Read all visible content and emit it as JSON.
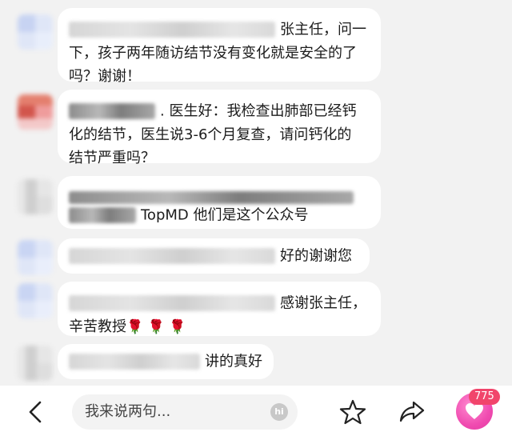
{
  "messages": [
    {
      "line1": "张主任，问一",
      "line2": "下，孩子两年随访结节没有变化就是安全的了",
      "line3": "吗？谢谢！"
    },
    {
      "line1": ". 医生好：我检查出肺部已经钙",
      "line2": "化的结节，医生说3-6个月复查，请问钙化的",
      "line3": "结节严重吗？"
    },
    {
      "line2": "TopMD 他们是这个公众号"
    },
    {
      "line1": "好的谢谢您"
    },
    {
      "line1": "感谢张主任，",
      "line2": "辛苦教授",
      "emoji": "🌹 🌹 🌹"
    },
    {
      "line1": "讲的真好"
    }
  ],
  "bottom_bar": {
    "input_placeholder": "我来说两句...",
    "hi_label": "hi",
    "like_count": "775",
    "icons": [
      "back-arrow-icon",
      "star-icon",
      "share-icon",
      "heart-icon"
    ]
  },
  "colors": {
    "background": "#f2f2f2",
    "bubble": "#ffffff",
    "like_gradient": "#f04bb0",
    "badge": "#f1456b"
  }
}
